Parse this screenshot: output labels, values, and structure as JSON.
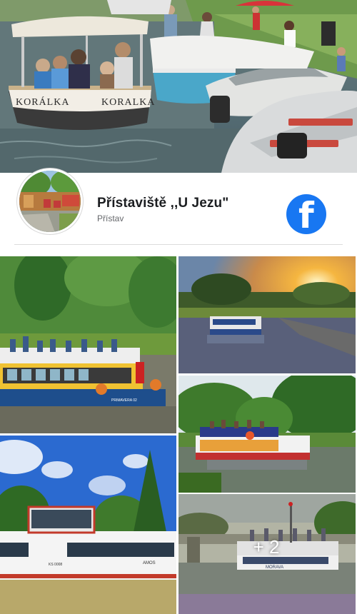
{
  "page": {
    "name": "Přístaviště ,,U Jezu\"",
    "category": "Přístav",
    "brand_color": "#1877f2"
  },
  "cover": {
    "boat_name_left": "KORÁLKA",
    "boat_name_right": "KORALKA"
  },
  "photos": [
    {
      "id": "photo-1",
      "boat_label": "PRIMAVERA 02"
    },
    {
      "id": "photo-2"
    },
    {
      "id": "photo-3"
    },
    {
      "id": "photo-4",
      "boat_label": "AMOS",
      "registration": "KS 0008"
    },
    {
      "id": "photo-5",
      "boat_label": "MORAVA"
    }
  ],
  "more_photos": {
    "label": "+ 2"
  },
  "icons": {
    "facebook": "facebook-logo-icon"
  }
}
